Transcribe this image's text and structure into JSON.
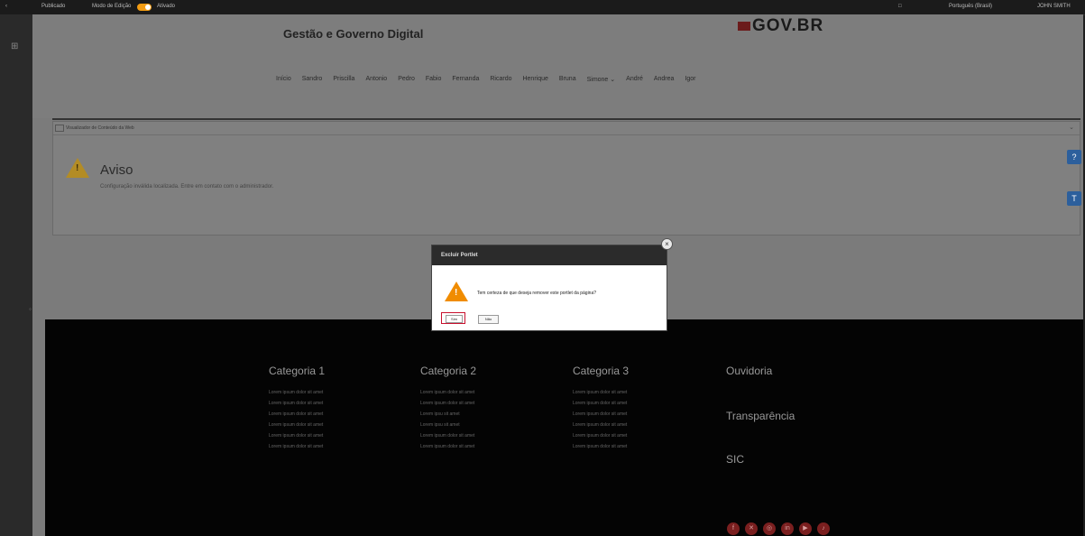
{
  "topbar": {
    "menu": "Publicado",
    "mode": "Modo de Edição",
    "toggle_label": "Ativado",
    "language": "Português (Brasil)",
    "user": "JOHN SMITH"
  },
  "header": {
    "site_title": "Gestão e Governo Digital",
    "logo": "GOV.BR",
    "nav": [
      "Início",
      "Sandro",
      "Priscilla",
      "Antonio",
      "Pedro",
      "Fabio",
      "Fernanda",
      "Ricardo",
      "Henrique",
      "Bruna",
      "Simone",
      "André",
      "Andrea",
      "Igor"
    ]
  },
  "portlet": {
    "header": "Visualizador de Conteúdo da Web",
    "title": "Aviso",
    "text": "Configuração inválida localizada. Entre em contato com o administrador."
  },
  "dialog": {
    "title": "Excluir Portlet",
    "message": "Tem certeza de que deseja remover este portlet da página?",
    "yes": "Sim",
    "no": "Não"
  },
  "footer": {
    "columns": [
      {
        "title": "Categoria 1",
        "links": [
          "Lorem ipsum dolor sit amet",
          "Lorem ipsum dolor sit amet",
          "Lorem ipsum dolor sit amet",
          "Lorem ipsum dolor sit amet",
          "Lorem ipsum dolor sit amet",
          "Lorem ipsum dolor sit amet"
        ]
      },
      {
        "title": "Categoria 2",
        "links": [
          "Lorem ipsum dolor sit amet",
          "Lorem ipsum dolor sit amet",
          "Lorem ipsu        sit amet",
          "Lorem ipsu        sit amet",
          "Lorem ipsum dolor sit amet",
          "Lorem ipsum dolor sit amet"
        ]
      },
      {
        "title": "Categoria 3",
        "links": [
          "Lorem ipsum dolor sit amet",
          "Lorem ipsum dolor sit amet",
          "Lorem ipsum dolor sit amet",
          "Lorem ipsum dolor sit amet",
          "Lorem ipsum dolor sit amet",
          "Lorem ipsum dolor sit amet"
        ]
      }
    ],
    "right_links": [
      "Ouvidoria",
      "Transparência",
      "SIC"
    ],
    "social": [
      "facebook-icon",
      "x-icon",
      "instagram-icon",
      "linkedin-icon",
      "youtube-icon",
      "tiktok-icon"
    ]
  },
  "colors": {
    "accent": "#f39c12",
    "danger": "#c8102e",
    "social": "#7a1f1f"
  }
}
